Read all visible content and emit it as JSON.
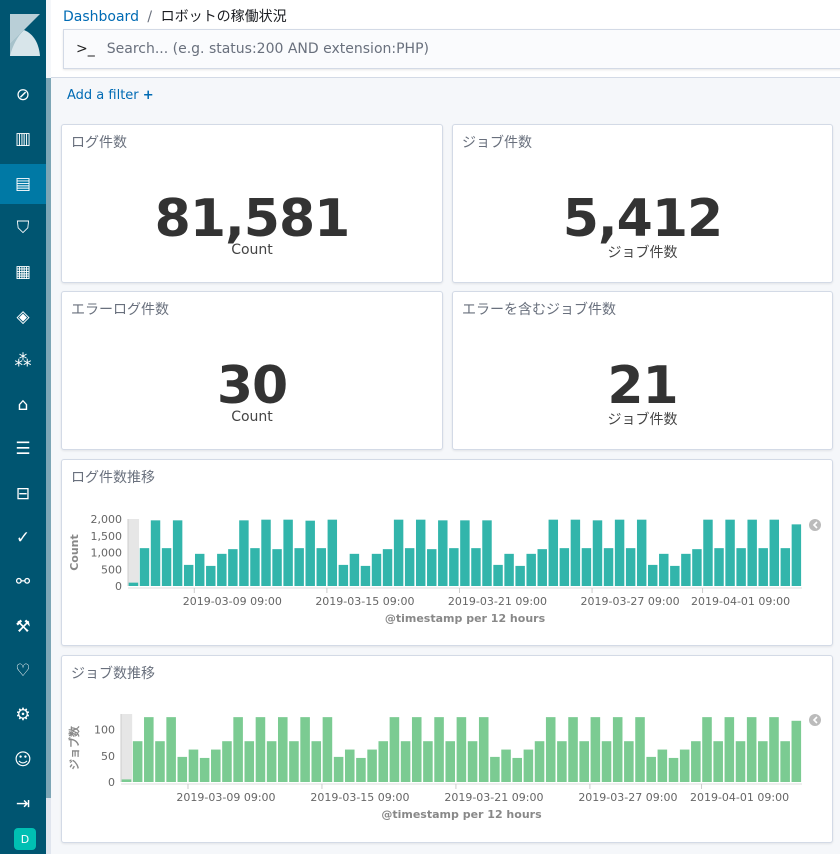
{
  "breadcrumb": {
    "root": "Dashboard",
    "separator": "/",
    "current": "ロボットの稼働状況"
  },
  "search": {
    "prompt": ">_",
    "placeholder": "Search... (e.g. status:200 AND extension:PHP)"
  },
  "filter": {
    "label": "Add a filter",
    "icon": "+"
  },
  "sidebar": {
    "items": [
      "compass-icon",
      "visualize-icon",
      "dashboard-icon",
      "timelion-icon",
      "canvas-icon",
      "maps-icon",
      "ml-icon",
      "infrastructure-icon",
      "logs-icon",
      "apm-icon",
      "uptime-icon",
      "graph-icon",
      "devtools-icon",
      "monitoring-icon",
      "management-icon",
      "user-icon",
      "logout-icon"
    ],
    "active": 2,
    "avatar": "D"
  },
  "colors": {
    "sidebar": "#005571",
    "chart1": "#32b5ab",
    "chart2": "#7bcb92",
    "link": "#006bb4"
  },
  "metrics": [
    {
      "title": "ログ件数",
      "value": "81,581",
      "label": "Count"
    },
    {
      "title": "ジョブ件数",
      "value": "5,412",
      "label": "ジョブ件数"
    },
    {
      "title": "エラーログ件数",
      "value": "30",
      "label": "Count"
    },
    {
      "title": "エラーを含むジョブ件数",
      "value": "21",
      "label": "ジョブ件数"
    }
  ],
  "chart_data": [
    {
      "type": "bar",
      "title": "ログ件数推移",
      "xlabel": "@timestamp per 12 hours",
      "ylabel": "Count",
      "ylim": [
        0,
        2000
      ],
      "yticks": [
        "0",
        "500",
        "1,000",
        "1,500",
        "2,000"
      ],
      "x_start": "2019-03-06 09:00",
      "xticks": [
        "2019-03-09 09:00",
        "2019-03-15 09:00",
        "2019-03-21 09:00",
        "2019-03-27 09:00",
        "2019-04-01 09:00"
      ],
      "grid": false,
      "values": [
        100,
        1130,
        1960,
        1130,
        1960,
        630,
        960,
        600,
        960,
        1100,
        1960,
        1130,
        1980,
        1100,
        1980,
        1130,
        1950,
        1130,
        1980,
        630,
        960,
        600,
        960,
        1100,
        1980,
        1130,
        1980,
        1100,
        1960,
        1130,
        1960,
        1130,
        1960,
        630,
        960,
        600,
        960,
        1100,
        1980,
        1130,
        1980,
        1130,
        1960,
        1130,
        1980,
        1130,
        1980,
        630,
        960,
        600,
        960,
        1100,
        1980,
        1130,
        1980,
        1130,
        1980,
        1130,
        1980,
        1130,
        1840
      ]
    },
    {
      "type": "bar",
      "title": "ジョブ数推移",
      "xlabel": "@timestamp per 12 hours",
      "ylabel": "ジョブ数",
      "ylim": [
        0,
        130
      ],
      "yticks": [
        "0",
        "50",
        "100"
      ],
      "x_start": "2019-03-06 09:00",
      "xticks": [
        "2019-03-09 09:00",
        "2019-03-15 09:00",
        "2019-03-21 09:00",
        "2019-03-27 09:00",
        "2019-04-01 09:00"
      ],
      "grid": false,
      "values": [
        5,
        78,
        124,
        78,
        124,
        48,
        62,
        46,
        62,
        78,
        124,
        78,
        124,
        78,
        124,
        78,
        124,
        78,
        124,
        48,
        62,
        46,
        62,
        78,
        124,
        78,
        124,
        78,
        124,
        78,
        124,
        78,
        124,
        48,
        62,
        46,
        62,
        78,
        124,
        78,
        124,
        78,
        124,
        78,
        124,
        78,
        124,
        48,
        62,
        46,
        62,
        78,
        124,
        78,
        124,
        78,
        124,
        78,
        124,
        78,
        117
      ]
    }
  ]
}
